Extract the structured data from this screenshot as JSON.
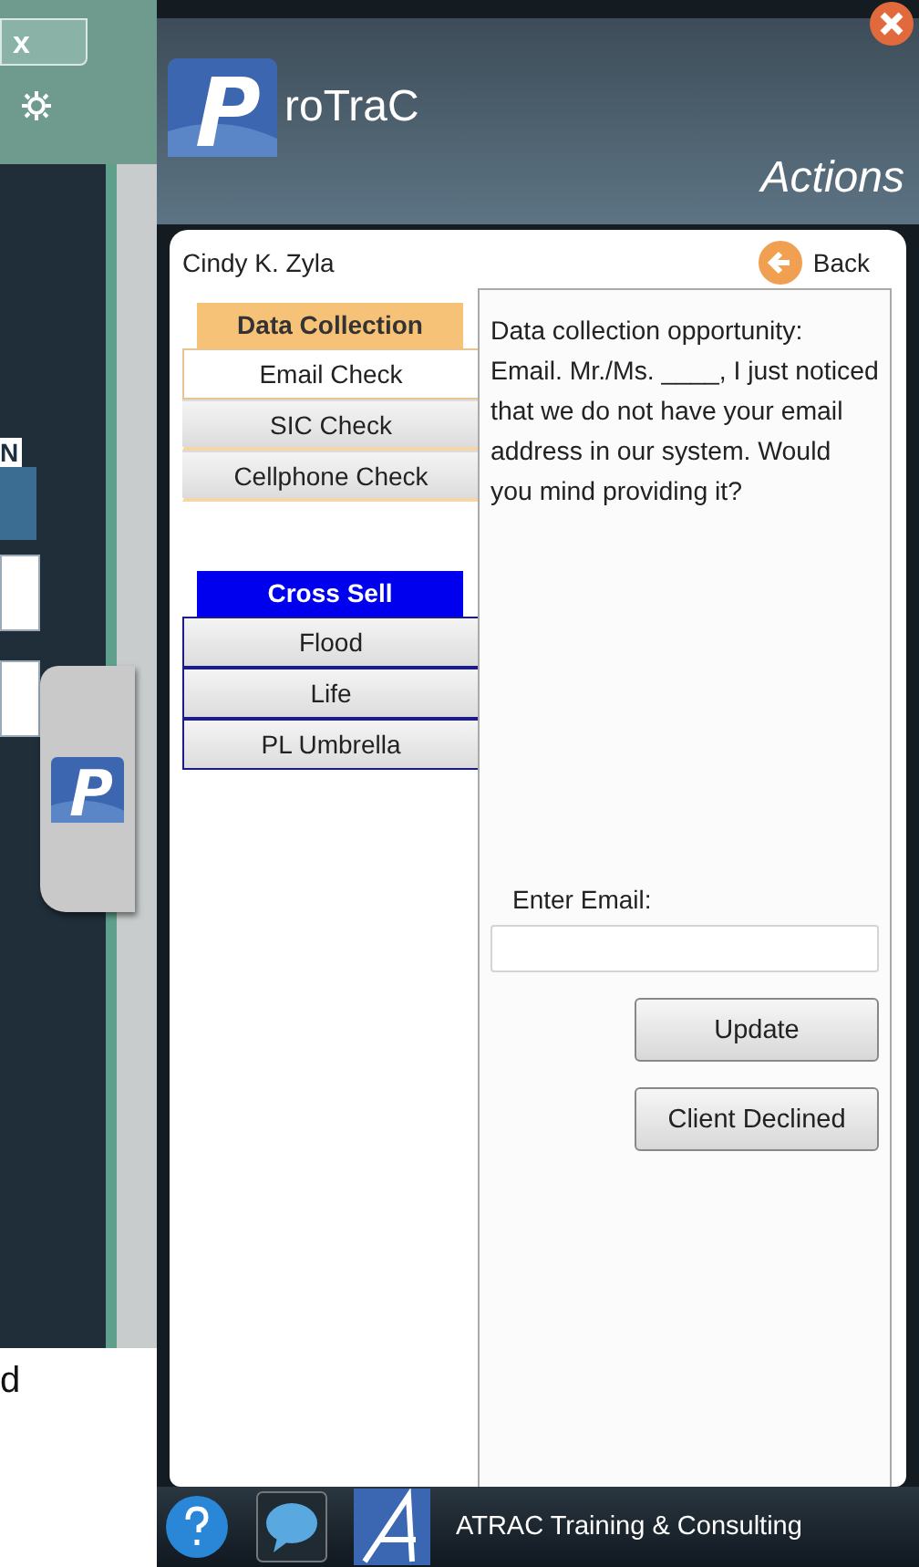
{
  "background_window": {
    "close_label": "x",
    "texts": [
      "N",
      "d"
    ]
  },
  "header": {
    "logo_text": "roTraC",
    "subtitle": "Actions"
  },
  "customer": {
    "name": "Cindy K. Zyla"
  },
  "back_button": {
    "label": "Back"
  },
  "menu_groups": [
    {
      "title": "Data Collection",
      "kind": "data",
      "items": [
        {
          "label": "Email Check",
          "selected": true
        },
        {
          "label": "SIC Check",
          "selected": false
        },
        {
          "label": "Cellphone Check",
          "selected": false
        }
      ]
    },
    {
      "title": "Cross Sell",
      "kind": "cross",
      "items": [
        {
          "label": "Flood",
          "selected": false
        },
        {
          "label": "Life",
          "selected": false
        },
        {
          "label": "PL Umbrella",
          "selected": false
        }
      ]
    }
  ],
  "prompt": {
    "text": "Data collection opportunity: Email. Mr./Ms. ____, I just noticed that we do not have your email address in our system.  Would you mind providing it?"
  },
  "email_field": {
    "label": "Enter Email:"
  },
  "buttons": [
    "Update",
    "Client Declined"
  ],
  "footer": {
    "company": "ATRAC Training & Consulting"
  }
}
